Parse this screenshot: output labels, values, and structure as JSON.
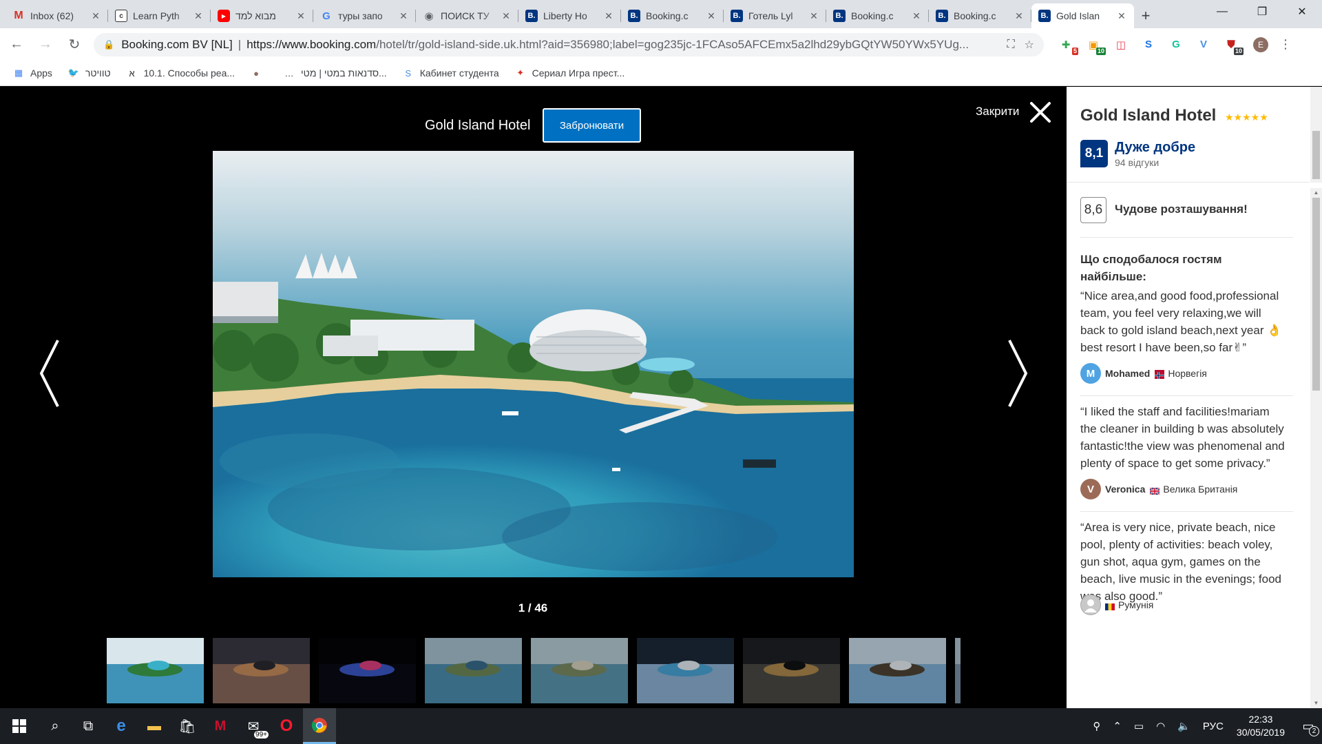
{
  "browser": {
    "tabs": [
      {
        "title": "Inbox (62)",
        "icon": "gmail-icon",
        "glyph": "M"
      },
      {
        "title": "Learn Pyth",
        "icon": "learn-icon",
        "glyph": "c"
      },
      {
        "title": "מבוא למד",
        "icon": "youtube-icon",
        "glyph": "▶"
      },
      {
        "title": "туры запо",
        "icon": "google-icon",
        "glyph": "G"
      },
      {
        "title": "ПОИСК ТУ",
        "icon": "globe-icon",
        "glyph": "◉"
      },
      {
        "title": "Liberty Ho",
        "icon": "booking-icon",
        "glyph": "B."
      },
      {
        "title": "Booking.c",
        "icon": "booking-icon",
        "glyph": "B."
      },
      {
        "title": "Готель Lyl",
        "icon": "booking-icon",
        "glyph": "B."
      },
      {
        "title": "Booking.c",
        "icon": "booking-icon",
        "glyph": "B."
      },
      {
        "title": "Booking.c",
        "icon": "booking-icon",
        "glyph": "B."
      },
      {
        "title": "Gold Islan",
        "icon": "booking-icon",
        "glyph": "B.",
        "active": true
      }
    ],
    "address": {
      "org": "Booking.com BV [NL]",
      "url_host": "https://www.booking.com",
      "url_path": "/hotel/tr/gold-island-side.uk.html?aid=356980;label=gog235jc-1FCAso5AFCEmx5a2lhd29ybGQtYW50YWx5YUg..."
    },
    "extensions": [
      {
        "name": "ext-green-icon",
        "glyph": "✚",
        "color": "#34a853",
        "badge": "5",
        "badge_color": "#d93025"
      },
      {
        "name": "ext-orange-icon",
        "glyph": "▣",
        "color": "#f29900",
        "badge": "10",
        "badge_color": "#188038"
      },
      {
        "name": "ext-pocket-icon",
        "glyph": "◫",
        "color": "#e8384f",
        "badge": "",
        "badge_color": ""
      },
      {
        "name": "ext-s-icon",
        "glyph": "S",
        "color": "#1a73e8",
        "badge": "",
        "badge_color": ""
      },
      {
        "name": "ext-grammarly-icon",
        "glyph": "G",
        "color": "#15c39a",
        "badge": "",
        "badge_color": ""
      },
      {
        "name": "ext-v-icon",
        "glyph": "V",
        "color": "#4a90e2",
        "badge": "",
        "badge_color": ""
      },
      {
        "name": "ext-red-icon",
        "glyph": "⛊",
        "color": "#c5221f",
        "badge": "10",
        "badge_color": "#3c4043"
      }
    ],
    "profile_initial": "E",
    "bookmarks": [
      {
        "label": "Apps",
        "icon": "apps-icon",
        "glyph": "▦",
        "color": "#4285f4"
      },
      {
        "label": "טוויטר",
        "icon": "twitter-icon",
        "glyph": "🐦",
        "color": "#1da1f2"
      },
      {
        "label": "10.1. Способы реа...",
        "icon": "hebrew-icon",
        "glyph": "א",
        "color": "#333"
      },
      {
        "label": "",
        "icon": "avatar-icon",
        "glyph": "●",
        "color": "#8d6e63"
      },
      {
        "label": "סדנאות במטי | מטי...",
        "icon": "dots-icon",
        "glyph": "…",
        "color": "#333"
      },
      {
        "label": "Кабинет студента",
        "icon": "student-icon",
        "glyph": "S",
        "color": "#4a90e2"
      },
      {
        "label": "Сериал Игра прест...",
        "icon": "serial-icon",
        "glyph": "✦",
        "color": "#d93025"
      }
    ]
  },
  "gallery": {
    "hotel_title": "Gold Island Hotel",
    "book_label": "Забронювати",
    "close_label": "Закрити",
    "counter": "1 / 46",
    "thumbnails": [
      {
        "name": "thumb-1",
        "style": "aerial"
      },
      {
        "name": "thumb-2",
        "style": "sunset"
      },
      {
        "name": "thumb-3",
        "style": "night"
      },
      {
        "name": "thumb-4",
        "style": "coast"
      },
      {
        "name": "thumb-5",
        "style": "peninsula"
      },
      {
        "name": "thumb-6",
        "style": "pool"
      },
      {
        "name": "thumb-7",
        "style": "dusk"
      },
      {
        "name": "thumb-8",
        "style": "ship"
      },
      {
        "name": "thumb-9",
        "style": "partial"
      }
    ]
  },
  "panel": {
    "hotel_name": "Gold Island Hotel",
    "stars": "★★★★★",
    "score": "8,1",
    "score_word": "Дуже добре",
    "reviews_count": "94 відгуки",
    "location_score": "8,6",
    "location_text": "Чудове розташування!",
    "liked_heading": "Що сподобалося гостям найбільше:",
    "reviews": [
      {
        "text": "“Nice area,and good food,professional team, you feel very relaxing,we will back to gold island beach,next year 👌 best resort I have been,so far✌”",
        "author": "Mohamed",
        "initial": "M",
        "avatar_color": "#4fa3e3",
        "country": "Норвегія",
        "flag": "norway"
      },
      {
        "text": "“I liked the staff and facilities!mariam the cleaner in building b was absolutely fantastic!the view was phenomenal and plenty of space to get some privacy.”",
        "author": "Veronica",
        "initial": "V",
        "avatar_color": "#9c6b57",
        "country": "Велика Британія",
        "flag": "uk"
      },
      {
        "text": "“Area is very nice, private beach, nice pool, plenty of activities: beach voley, gun shot, aqua gym, games on the beach, live music in the evenings; food was also good.”",
        "author": "",
        "initial": "",
        "avatar_color": "#c8c8c8",
        "country": "Румунія",
        "flag": "romania"
      }
    ]
  },
  "taskbar": {
    "mail_badge": "99+",
    "language": "РУС",
    "time": "22:33",
    "date": "30/05/2019",
    "notifications": "2"
  }
}
